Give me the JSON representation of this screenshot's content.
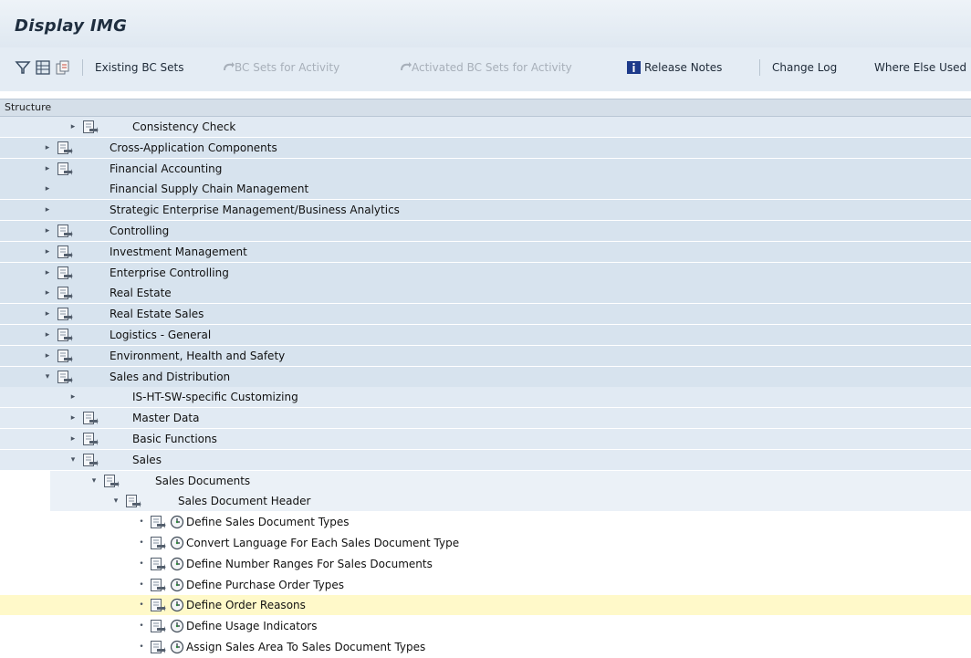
{
  "window": {
    "title": "Display IMG"
  },
  "toolbar": {
    "existing_bc_sets": "Existing BC Sets",
    "bc_sets_for_activity": "BC Sets for Activity",
    "activated_bc_sets": "Activated BC Sets for Activity",
    "release_notes": "Release Notes",
    "change_log": "Change Log",
    "where_else_used": "Where Else Used"
  },
  "structure": {
    "header": "Structure",
    "items": [
      {
        "label": "Consistency Check"
      },
      {
        "label": "Cross-Application Components"
      },
      {
        "label": "Financial Accounting"
      },
      {
        "label": "Financial Supply Chain Management"
      },
      {
        "label": "Strategic Enterprise Management/Business Analytics"
      },
      {
        "label": "Controlling"
      },
      {
        "label": "Investment Management"
      },
      {
        "label": "Enterprise Controlling"
      },
      {
        "label": "Real Estate"
      },
      {
        "label": "Real Estate Sales"
      },
      {
        "label": "Logistics - General"
      },
      {
        "label": "Environment, Health and Safety"
      },
      {
        "label": "Sales and Distribution"
      },
      {
        "label": "IS-HT-SW-specific Customizing"
      },
      {
        "label": "Master Data"
      },
      {
        "label": "Basic Functions"
      },
      {
        "label": "Sales"
      },
      {
        "label": "Sales Documents"
      },
      {
        "label": "Sales Document Header"
      },
      {
        "label": "Define Sales Document Types"
      },
      {
        "label": "Convert Language For Each Sales Document Type"
      },
      {
        "label": "Define Number Ranges For Sales Documents"
      },
      {
        "label": "Define Purchase Order Types"
      },
      {
        "label": "Define Order Reasons"
      },
      {
        "label": "Define Usage Indicators"
      },
      {
        "label": "Assign Sales Area To Sales Document Types"
      }
    ]
  },
  "colors": {
    "level0": "#d7e3ee",
    "level1": "#e1eaf3",
    "level2": "#ebf1f7",
    "selected": "#fff9c9"
  }
}
